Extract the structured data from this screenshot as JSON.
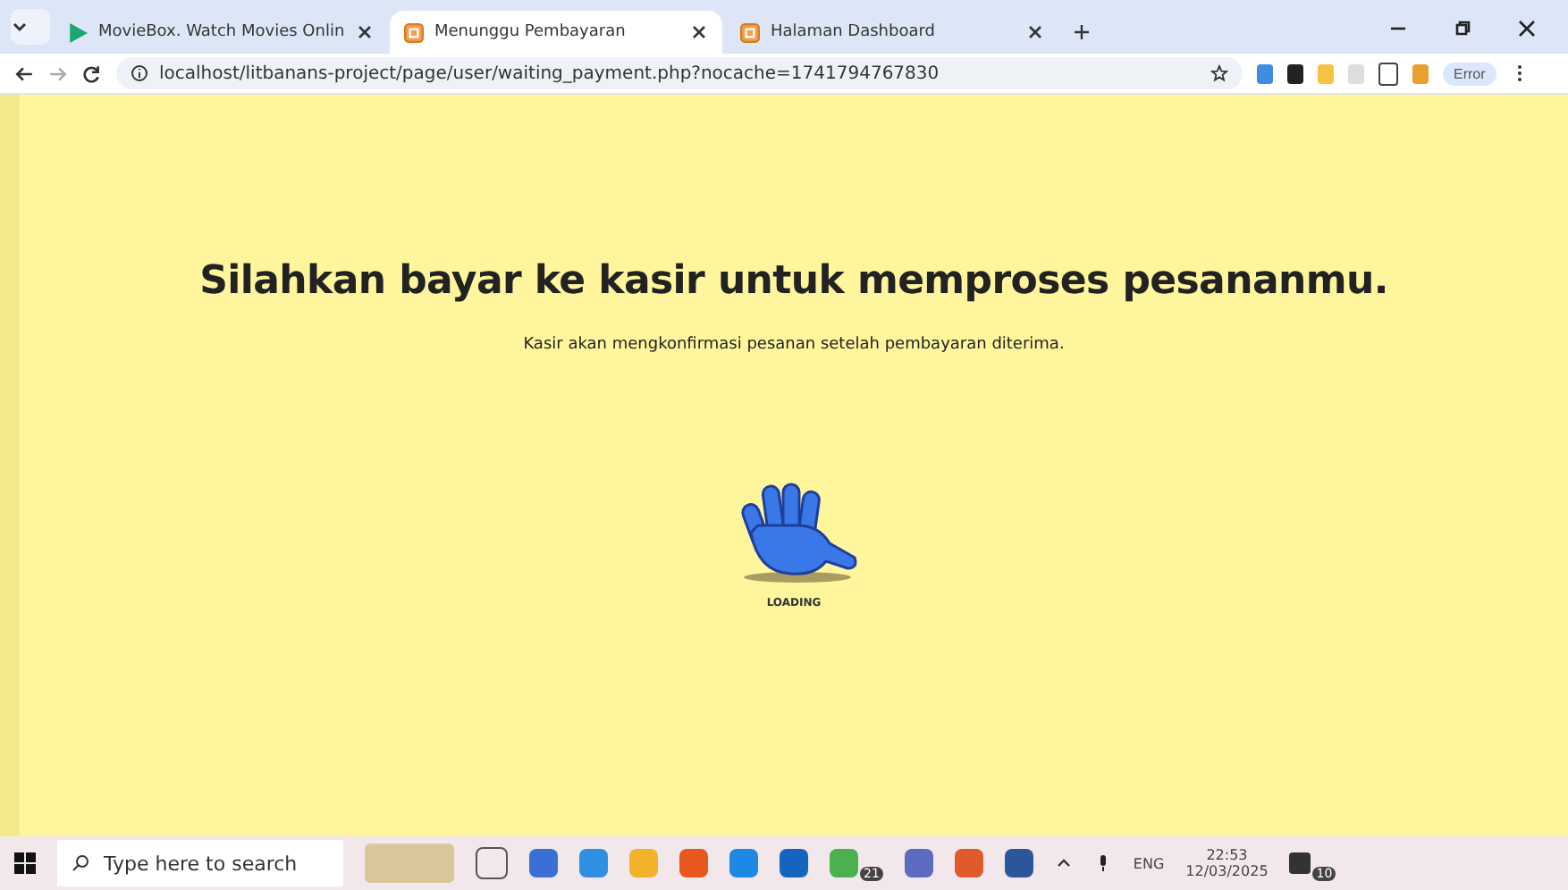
{
  "browser": {
    "tabs": [
      {
        "title": "MovieBox. Watch Movies Onlin",
        "kind": "play",
        "selected": false
      },
      {
        "title": "Menunggu Pembayaran",
        "kind": "page",
        "selected": true
      },
      {
        "title": "Halaman Dashboard",
        "kind": "page",
        "selected": false
      }
    ],
    "url": "localhost/litbanans-project/page/user/waiting_payment.php?nocache=1741794767830",
    "profile_button": "Error"
  },
  "page": {
    "heading": "Silahkan bayar ke kasir untuk memproses pesananmu.",
    "message": "Kasir akan mengkonfirmasi pesanan setelah pembayaran diterima.",
    "loading_label": "LOADING"
  },
  "taskbar": {
    "search_placeholder": "Type here to search",
    "whatsapp_badge": "21",
    "language": "ENG",
    "time": "22:53",
    "date": "12/03/2025",
    "notification_badge": "10"
  }
}
